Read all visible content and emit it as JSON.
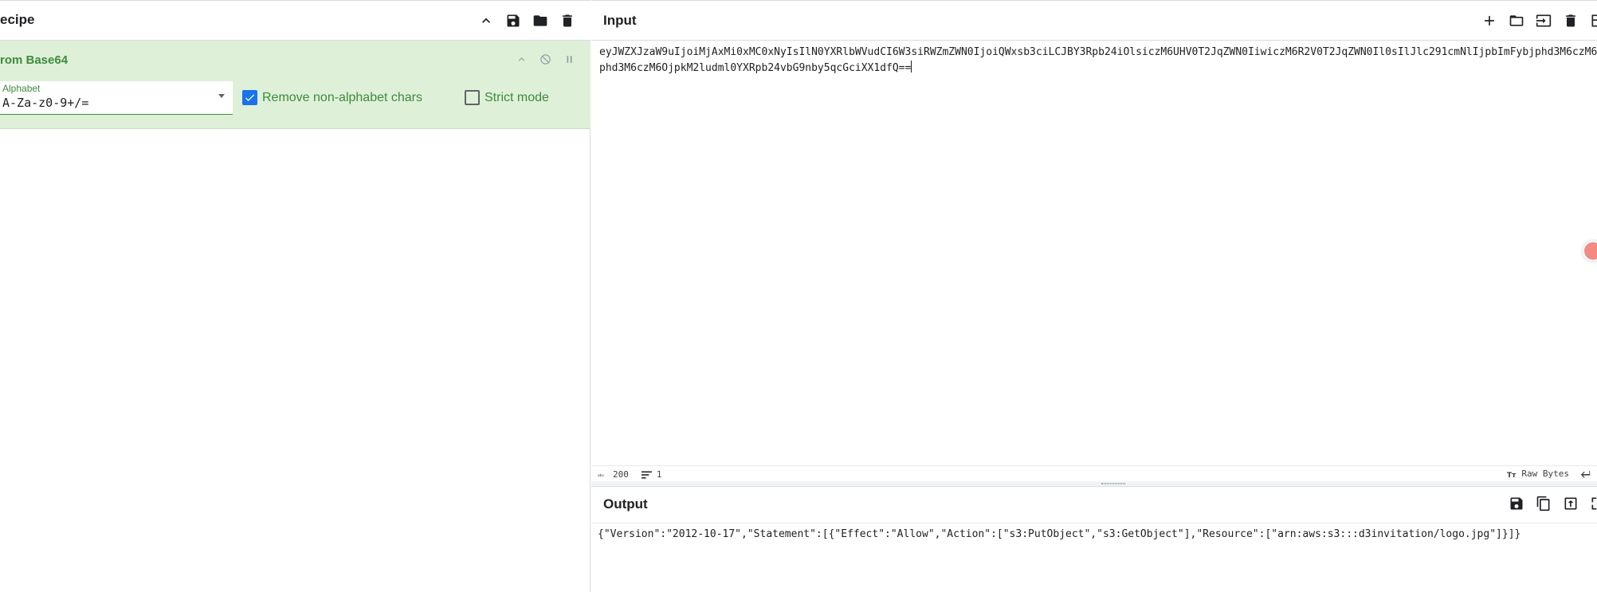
{
  "recipe": {
    "title": "ecipe",
    "operation": {
      "name": "rom Base64",
      "alphabet_label": "Alphabet",
      "alphabet_value": "A-Za-z0-9+/=",
      "remove_label": "Remove non-alphabet chars",
      "remove_checked": true,
      "strict_label": "Strict mode",
      "strict_checked": false
    }
  },
  "input": {
    "title": "Input",
    "text_line1": "eyJWZXJzaW9uIjoiMjAxMi0xMC0xNyIsIlN0YXRlbWVudCI6W3siRWZmZWN0IjoiQWxsb3ciLCJBY3Rpb24iOlsiczM6UHV0T2JqZWN0IiwiczM6R2V0T2JqZWN0Il0sIlJlc291cmNlIjpbImFybjphd3M6czM6OjpkM2ludml0YXRpb24vbG9nby5qcGciXX1dfQ==",
    "text_line2": "phd3M6czM6OjpkM2ludml0YXRpb24vbG9nby5qcGciXX1dfQ==",
    "status": {
      "chars": "200",
      "lines": "1",
      "encoding": "Raw Bytes"
    }
  },
  "output": {
    "title": "Output",
    "text": "{\"Version\":\"2012-10-17\",\"Statement\":[{\"Effect\":\"Allow\",\"Action\":[\"s3:PutObject\",\"s3:GetObject\"],\"Resource\":[\"arn:aws:s3:::d3invitation/logo.jpg\"]}]}"
  },
  "icons": {
    "recipe_header": [
      "chevron-up-icon",
      "save-icon",
      "folder-icon",
      "trash-icon"
    ],
    "operation": [
      "chevron-up-icon",
      "disable-icon",
      "pause-icon"
    ],
    "input_header": [
      "plus-icon",
      "folder-icon",
      "import-icon",
      "trash-icon",
      "layout-icon"
    ],
    "output_header": [
      "save-icon",
      "copy-icon",
      "export-icon",
      "maximize-icon"
    ]
  },
  "colors": {
    "accent_green": "#3c8b3c",
    "card_bg": "#dff0d8",
    "checkbox_blue": "#1a73e8"
  }
}
